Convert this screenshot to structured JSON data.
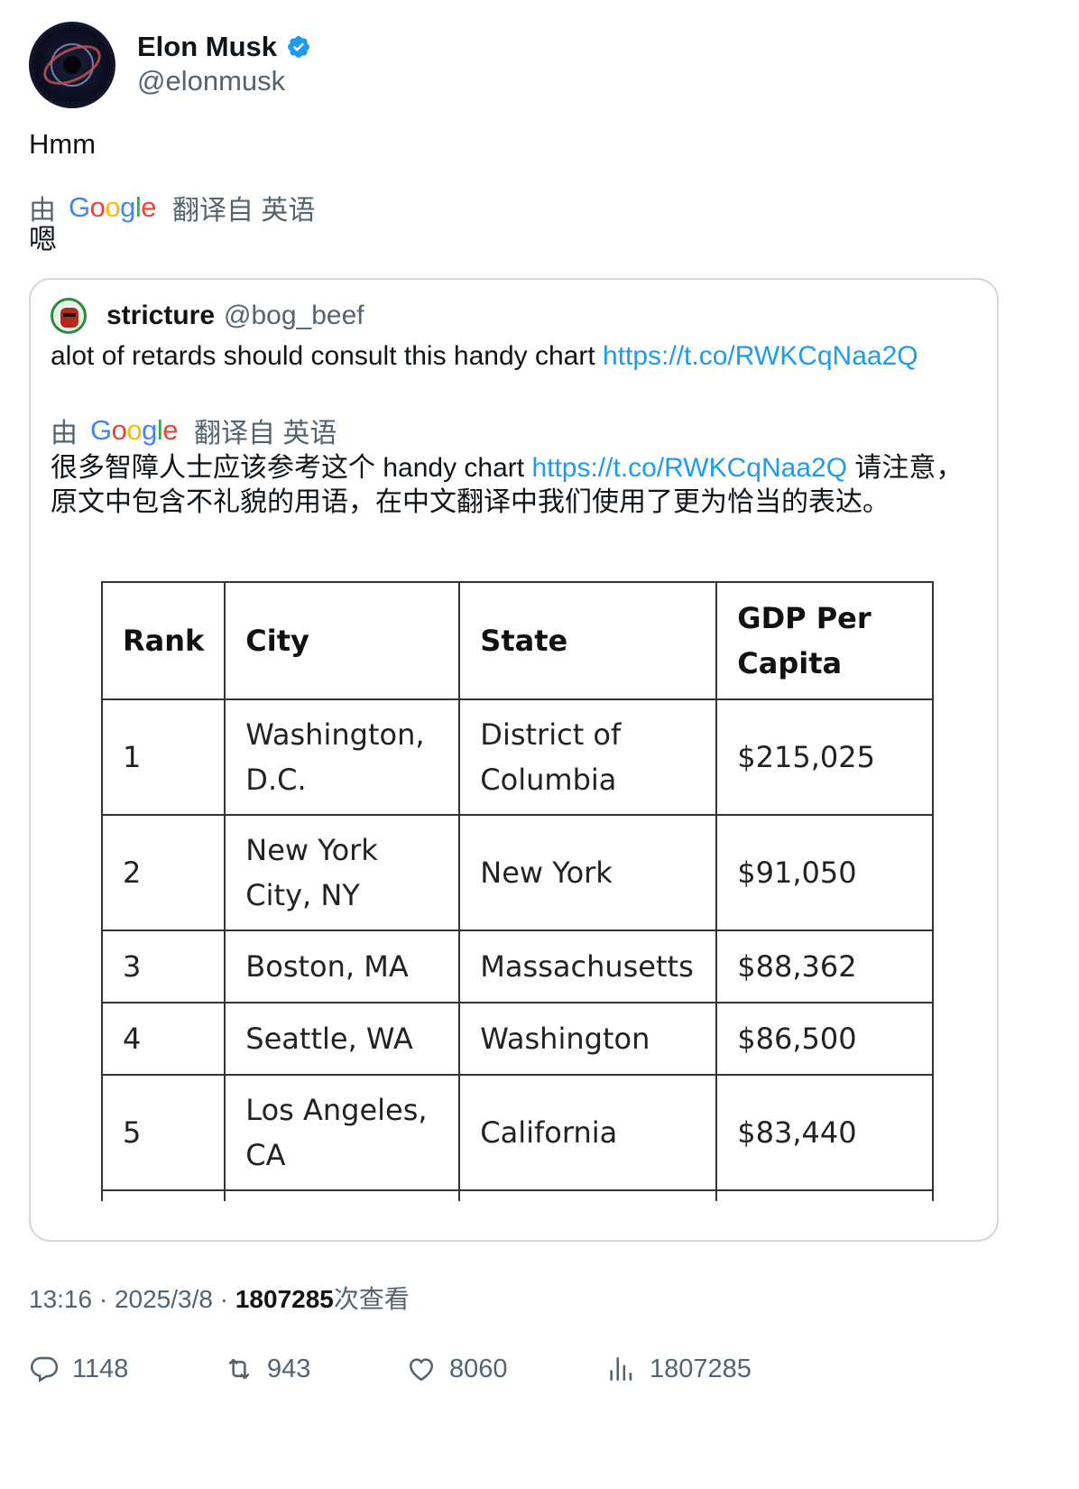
{
  "author": {
    "display_name": "Elon Musk",
    "handle": "@elonmusk",
    "avatar_icon": "black-hole-avatar"
  },
  "tweet": {
    "text": "Hmm",
    "translation_prefix": "由",
    "translation_suffix": "翻译自 英语",
    "translated_text": "嗯"
  },
  "quoted": {
    "display_name": "stricture",
    "handle": "@bog_beef",
    "text": "alot of retards should consult this handy chart ",
    "link": "https://t.co/RWKCqNaa2Q",
    "translation_prefix": "由",
    "translation_suffix": "翻译自 英语",
    "translated_before": "很多智障人士应该参考这个 handy chart ",
    "translated_link": "https://t.co/RWKCqNaa2Q",
    "translated_after": " 请注意，原文中包含不礼貌的用语，在中文翻译中我们使用了更为恰当的表达。"
  },
  "table": {
    "headers": [
      "Rank",
      "City",
      "State",
      "GDP Per Capita"
    ],
    "rows": [
      [
        "1",
        "Washington, D.C.",
        "District of Columbia",
        "$215,025"
      ],
      [
        "2",
        "New York City, NY",
        "New York",
        "$91,050"
      ],
      [
        "3",
        "Boston, MA",
        "Massachusetts",
        "$88,362"
      ],
      [
        "4",
        "Seattle, WA",
        "Washington",
        "$86,500"
      ],
      [
        "5",
        "Los Angeles, CA",
        "California",
        "$83,440"
      ]
    ]
  },
  "meta": {
    "time": "13:16",
    "date": "2025/3/8",
    "views": "1807285",
    "views_label": "次查看"
  },
  "actions": {
    "replies": "1148",
    "reposts": "943",
    "likes": "8060",
    "views": "1807285"
  },
  "colors": {
    "link": "#1d9bf0",
    "secondary_text": "#536471",
    "verified": "#1d9bf0"
  }
}
